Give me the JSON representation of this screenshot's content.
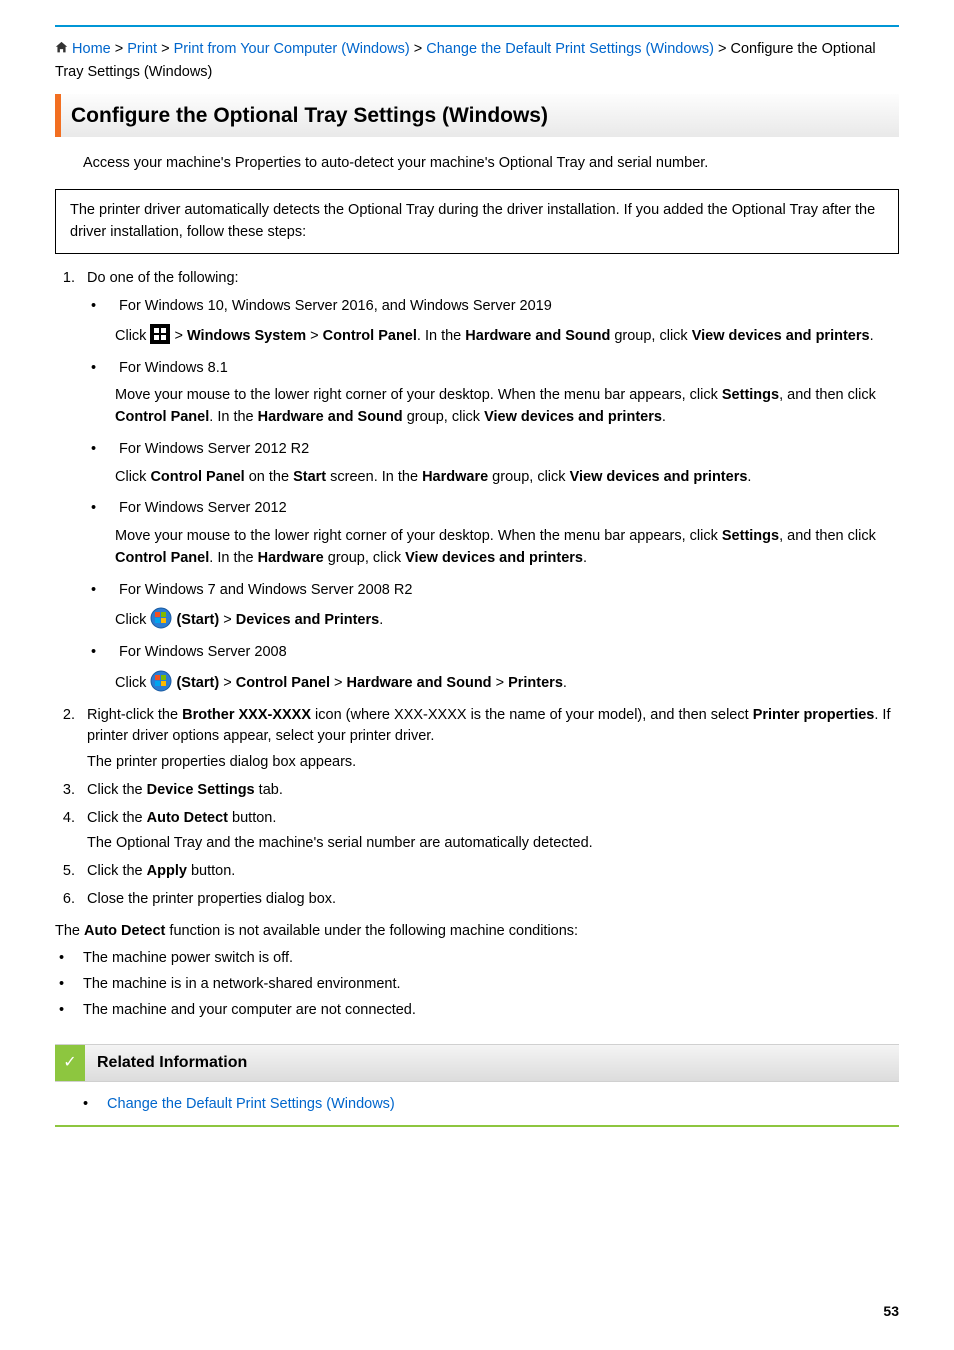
{
  "breadcrumb": {
    "home": "Home",
    "print": "Print",
    "from_pc": "Print from Your Computer (Windows)",
    "change_default": "Change the Default Print Settings (Windows)",
    "current": "Configure the Optional Tray Settings (Windows)"
  },
  "title": "Configure the Optional Tray Settings (Windows)",
  "intro": "Access your machine's Properties to auto-detect your machine's Optional Tray and serial number.",
  "note": "The printer driver automatically detects the Optional Tray during the driver installation. If you added the Optional Tray after the driver installation, follow these steps:",
  "step1": {
    "lead": "Do one of the following:",
    "os": {
      "a_head": "For Windows 10, Windows Server 2016, and Windows Server 2019",
      "a_click": "Click ",
      "a_seg1": " > ",
      "a_ws": "Windows System",
      "a_seg2": " > ",
      "a_cp": "Control Panel",
      "a_seg3": ". In the ",
      "a_hs": "Hardware and Sound",
      "a_seg4": " group, click ",
      "a_vdp": "View devices and printers",
      "a_seg5": ".",
      "b_head": "For Windows 8.1",
      "b_p1": "Move your mouse to the lower right corner of your desktop. When the menu bar appears, click ",
      "b_settings": "Settings",
      "b_p2": ", and then click ",
      "b_cp": "Control Panel",
      "b_p3": ". In the ",
      "b_hs": "Hardware and Sound",
      "b_p4": " group, click ",
      "b_vdp": "View devices and printers",
      "b_p5": ".",
      "c_head": "For Windows Server 2012 R2",
      "c_p1": "Click ",
      "c_cp": "Control Panel",
      "c_p2": " on the ",
      "c_start": "Start",
      "c_p3": " screen. In the ",
      "c_hw": "Hardware",
      "c_p4": " group, click ",
      "c_vdp": "View devices and printers",
      "c_p5": ".",
      "d_head": "For Windows Server 2012",
      "d_p1": "Move your mouse to the lower right corner of your desktop. When the menu bar appears, click ",
      "d_settings": "Settings",
      "d_p2": ", and then click ",
      "d_cp": "Control Panel",
      "d_p3": ". In the ",
      "d_hw": "Hardware",
      "d_p4": " group, click ",
      "d_vdp": "View devices and printers",
      "d_p5": ".",
      "e_head": "For Windows 7 and Windows Server 2008 R2",
      "e_click": "Click ",
      "e_start": " (Start)",
      "e_seg1": " > ",
      "e_dp": "Devices and Printers",
      "e_seg2": ".",
      "f_head": "For Windows Server 2008",
      "f_click": "Click ",
      "f_start": " (Start)",
      "f_seg1": " > ",
      "f_cp": "Control Panel",
      "f_seg2": " > ",
      "f_hs": "Hardware and Sound",
      "f_seg3": " > ",
      "f_pr": "Printers",
      "f_seg4": "."
    }
  },
  "step2": {
    "p1": "Right-click the ",
    "brother": "Brother XXX-XXXX",
    "p2": " icon (where XXX-XXXX is the name of your model), and then select ",
    "pp": "Printer properties",
    "p3": ". If printer driver options appear, select your printer driver.",
    "p4": "The printer properties dialog box appears."
  },
  "step3": {
    "p1": "Click the ",
    "ds": "Device Settings",
    "p2": " tab."
  },
  "step4": {
    "p1": "Click the ",
    "ad": "Auto Detect",
    "p2": " button.",
    "p3": "The Optional Tray and the machine's serial number are automatically detected."
  },
  "step5": {
    "p1": "Click the ",
    "ap": "Apply",
    "p2": " button."
  },
  "step6": {
    "p1": "Close the printer properties dialog box."
  },
  "after": {
    "p1a": "The ",
    "ad": "Auto Detect",
    "p1b": " function is not available under the following machine conditions:",
    "c1": "The machine power switch is off.",
    "c2": "The machine is in a network-shared environment.",
    "c3": "The machine and your computer are not connected."
  },
  "related": {
    "title": "Related Information",
    "link1": "Change the Default Print Settings (Windows)"
  },
  "page_number": "53"
}
